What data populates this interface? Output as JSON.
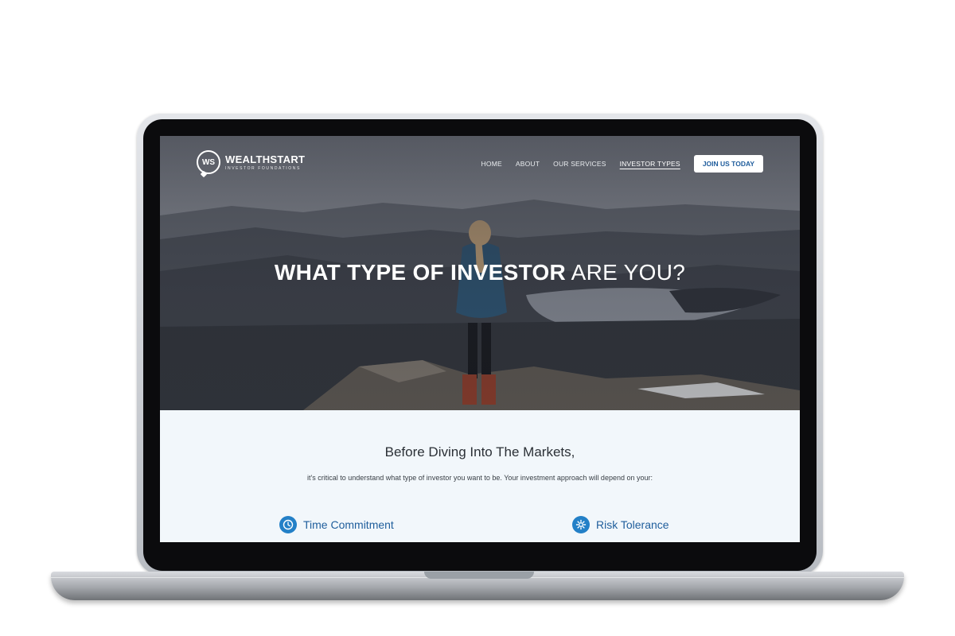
{
  "brand": {
    "mark": "WS",
    "name": "WEALTHSTART",
    "tagline": "INVESTOR FOUNDATIONS"
  },
  "nav": {
    "items": [
      {
        "label": "HOME"
      },
      {
        "label": "ABOUT"
      },
      {
        "label": "OUR SERVICES"
      },
      {
        "label": "INVESTOR TYPES",
        "active": true
      }
    ],
    "cta": "JOIN US TODAY"
  },
  "hero": {
    "title_bold": "WHAT TYPE OF INVESTOR",
    "title_rest": "ARE YOU?"
  },
  "intro": {
    "heading": "Before Diving Into The Markets,",
    "subtext": "it's critical to understand what type of investor you want to be. Your investment approach will depend on your:"
  },
  "features": [
    {
      "label": "Time Commitment",
      "icon": "clock-icon"
    },
    {
      "label": "Risk Tolerance",
      "icon": "gear-icon"
    }
  ],
  "colors": {
    "accent": "#1f5e9c",
    "icon_bg": "#2380c7",
    "section_bg": "#f2f7fb"
  }
}
